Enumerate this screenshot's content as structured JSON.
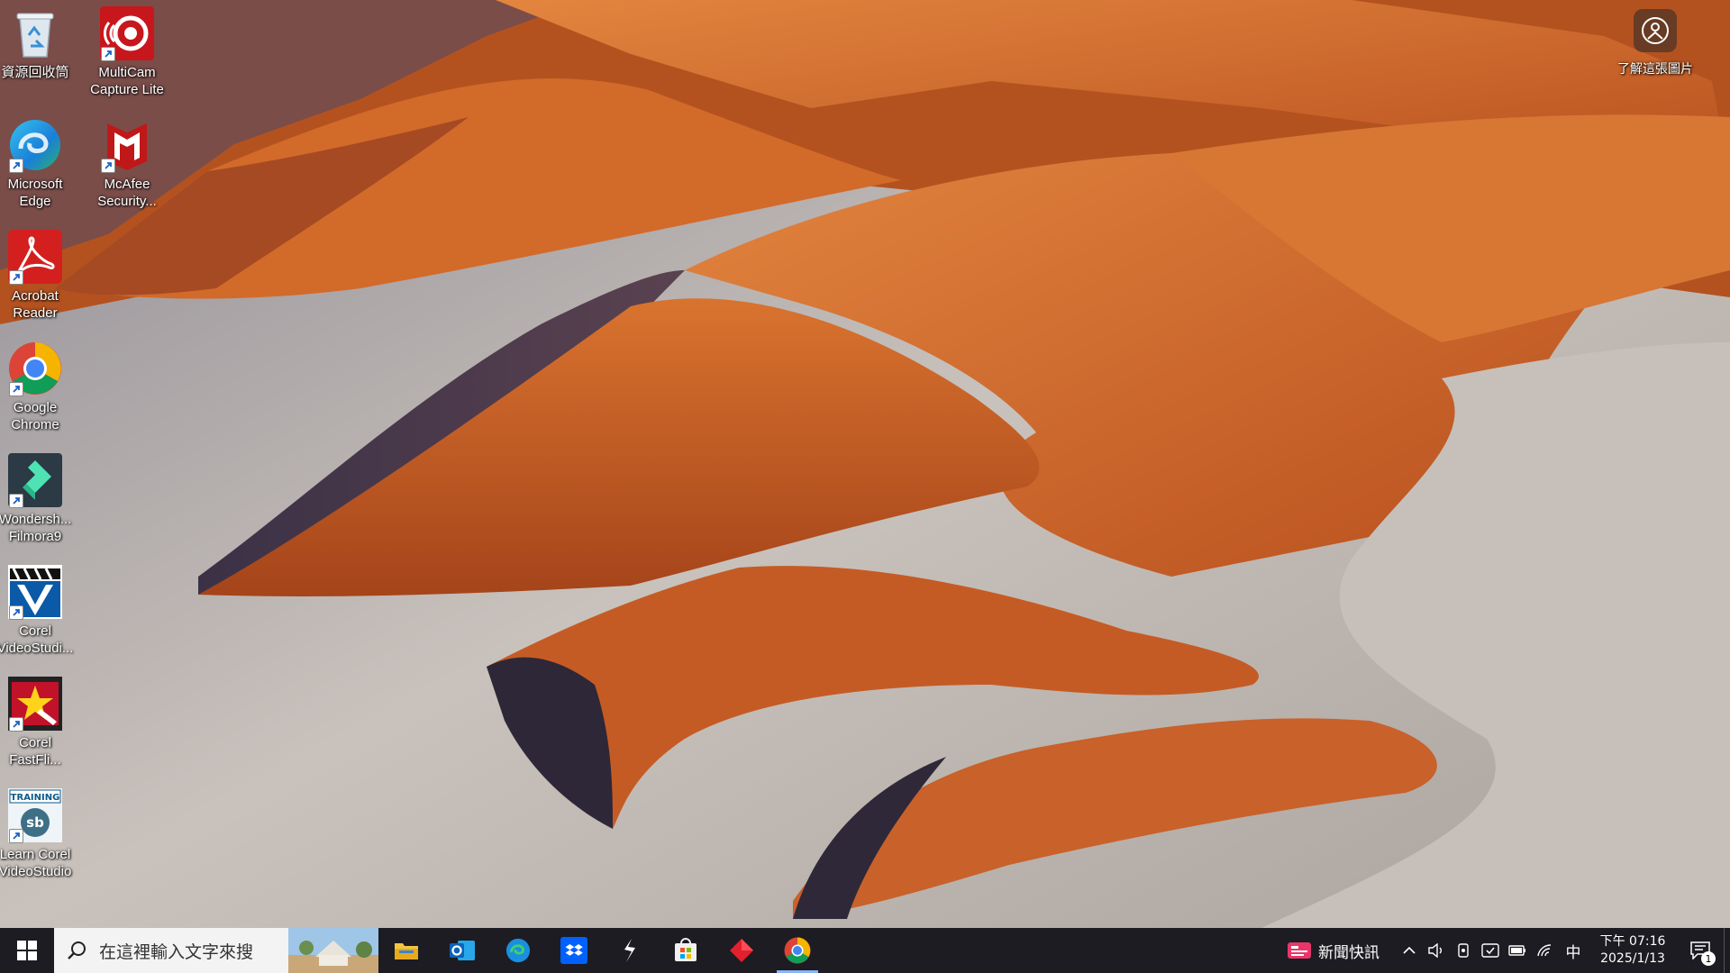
{
  "desktop": {
    "icons": [
      {
        "name": "recycle-bin",
        "label": "資源回收筒",
        "icon": "recycle-bin-icon",
        "shortcut": false
      },
      {
        "name": "multicam",
        "label": "MultiCam\nCapture Lite",
        "icon": "multicam-icon",
        "shortcut": true
      },
      {
        "name": "edge",
        "label": "Microsoft\nEdge",
        "icon": "edge-icon",
        "shortcut": true
      },
      {
        "name": "mcafee",
        "label": "McAfee\nSecurity...",
        "icon": "mcafee-icon",
        "shortcut": true
      },
      {
        "name": "acrobat",
        "label": "Acrobat\nReader",
        "icon": "acrobat-icon",
        "shortcut": true
      },
      {
        "name": "chrome",
        "label": "Google\nChrome",
        "icon": "chrome-icon",
        "shortcut": true
      },
      {
        "name": "filmora",
        "label": "Wondersh...\nFilmora9",
        "icon": "filmora-icon",
        "shortcut": true
      },
      {
        "name": "videostudio",
        "label": "Corel\nVideoStudi...",
        "icon": "videostudio-icon",
        "shortcut": true
      },
      {
        "name": "fastflick",
        "label": "Corel\nFastFli...",
        "icon": "fastflick-icon",
        "shortcut": true
      },
      {
        "name": "learn-videostudio",
        "label": "Learn Corel\nVideoStudio",
        "icon": "training-icon",
        "shortcut": true
      }
    ],
    "learn_about_picture": "了解這張圖片"
  },
  "taskbar": {
    "search_placeholder": "在這裡輸入文字來搜",
    "pinned_apps": [
      "file-explorer-icon",
      "outlook-icon",
      "edge-icon",
      "dropbox-icon",
      "capcut-icon",
      "microsoft-store-icon",
      "red-diamond-app-icon",
      "chrome-icon"
    ],
    "active_app": "chrome-icon",
    "news_label": "新聞快訊",
    "ime": "中",
    "time": "下午 07:16",
    "date": "2025/1/13",
    "notification_count": "1"
  },
  "colors": {
    "taskbar_bg": "#1c1c22",
    "dune_orange": "#c85a22",
    "dune_light": "#e07a35",
    "pan_grey": "#b9b3ad"
  }
}
